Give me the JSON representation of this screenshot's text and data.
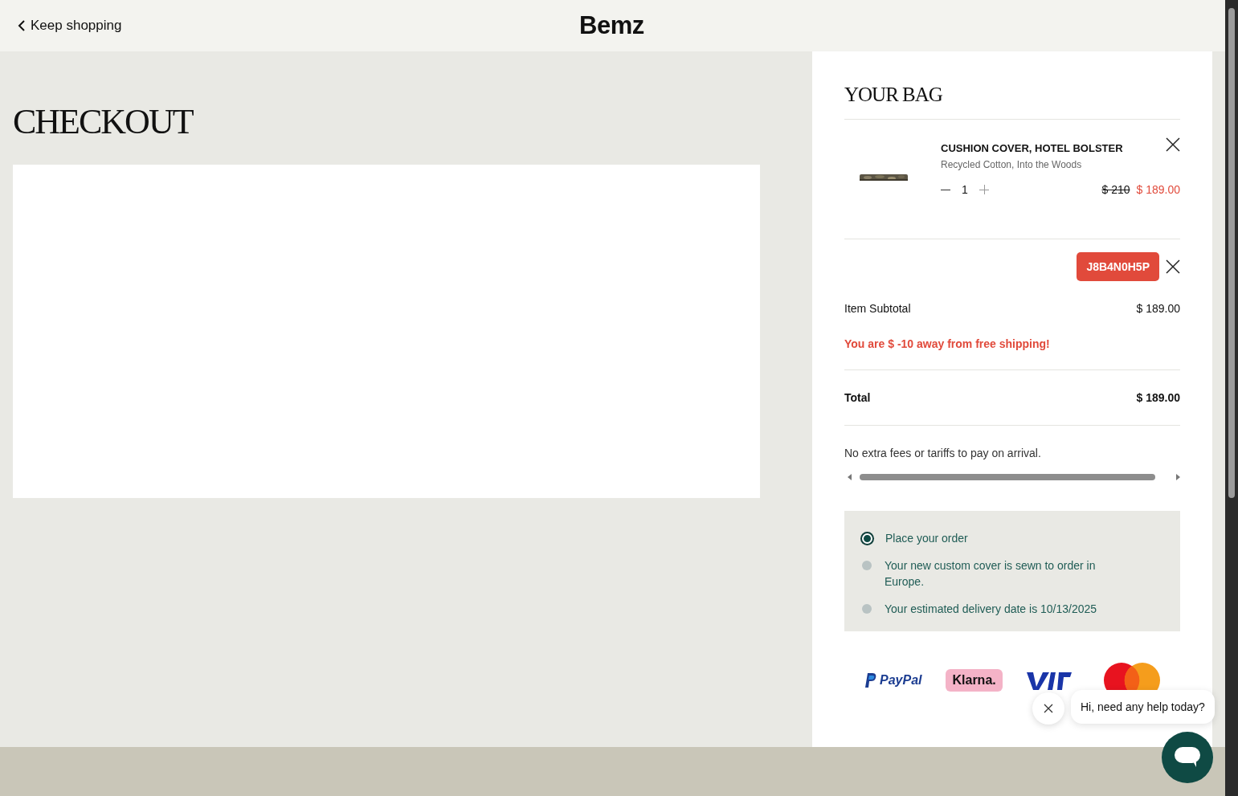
{
  "header": {
    "back_link": "Keep shopping",
    "logo": "Bemz"
  },
  "checkout": {
    "title": "CHECKOUT"
  },
  "bag": {
    "title": "YOUR BAG",
    "items": [
      {
        "name": "CUSHION COVER, HOTEL BOLSTER",
        "variant": "Recycled Cotton, Into the Woods",
        "quantity": "1",
        "old_price": "$ 210",
        "price": "$ 189.00"
      }
    ],
    "discount_code": "J8B4N0H5P",
    "subtotal": {
      "label": "Item Subtotal",
      "value": "$ 189.00"
    },
    "shipping_notice": "You are $ -10 away from free shipping!",
    "total": {
      "label": "Total",
      "value": "$ 189.00"
    },
    "fees_note": "No extra fees or tariffs to pay on arrival.",
    "steps": [
      {
        "text": "Place your order",
        "selected": true
      },
      {
        "text": "Your new custom cover is sewn to order in Europe.",
        "selected": false
      },
      {
        "text": "Your estimated delivery date is 10/13/2025",
        "selected": false
      }
    ],
    "payment_logos": [
      {
        "kind": "paypal",
        "text": "PayPal"
      },
      {
        "kind": "klarna",
        "text": "Klarna."
      },
      {
        "kind": "visa"
      },
      {
        "kind": "mastercard"
      }
    ]
  },
  "chat": {
    "message": "Hi, need any help today?"
  }
}
